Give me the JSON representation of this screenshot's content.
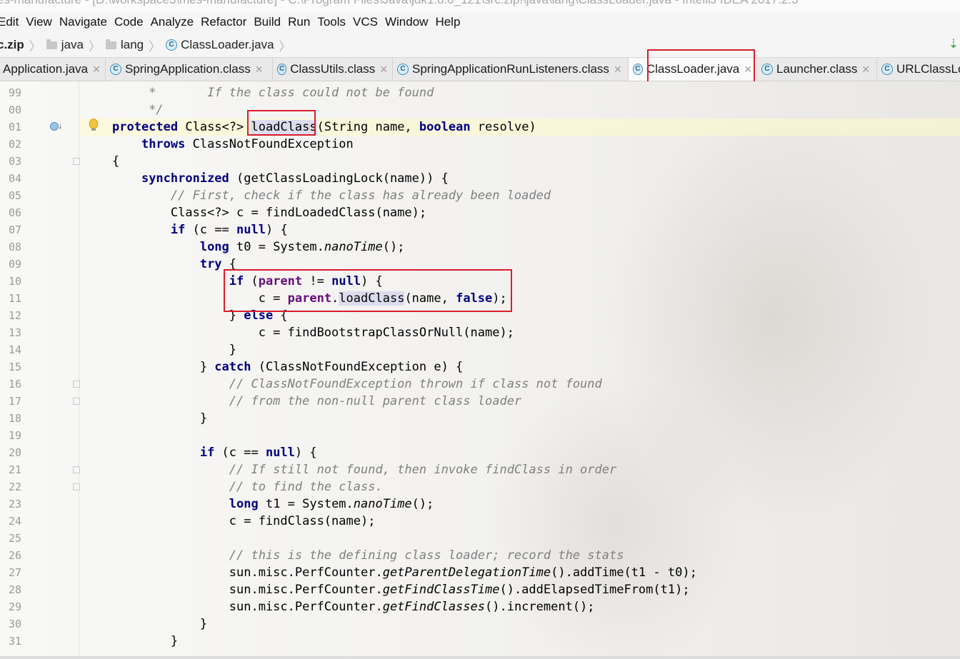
{
  "window": {
    "title": "es-manufacture - [D:\\workspace3\\mes-manufacture] - C:\\Program Files\\Java\\jdk1.8.0_121\\src.zip!\\java\\lang\\ClassLoader.java - IntelliJ IDEA 2017.2.3"
  },
  "menu": {
    "items": [
      "Edit",
      "View",
      "Navigate",
      "Code",
      "Analyze",
      "Refactor",
      "Build",
      "Run",
      "Tools",
      "VCS",
      "Window",
      "Help"
    ]
  },
  "breadcrumb": {
    "items": [
      {
        "label": "c.zip",
        "icon": "archive"
      },
      {
        "label": "java",
        "icon": "folder-icon"
      },
      {
        "label": "lang",
        "icon": "folder-icon"
      },
      {
        "label": "ClassLoader.java",
        "icon": "class-icon"
      }
    ],
    "right_icon": "green-down-arrow-icon"
  },
  "tabs": [
    {
      "label": "Application.java",
      "icon": "none",
      "active": false
    },
    {
      "label": "SpringApplication.class",
      "icon": "class-icon",
      "active": false
    },
    {
      "label": "ClassUtils.class",
      "icon": "class-icon",
      "active": false
    },
    {
      "label": "SpringApplicationRunListeners.class",
      "icon": "class-icon",
      "active": false
    },
    {
      "label": "ClassLoader.java",
      "icon": "class-icon",
      "active": true
    },
    {
      "label": "Launcher.class",
      "icon": "class-icon",
      "active": false
    },
    {
      "label": "URLClassLo",
      "icon": "class-icon",
      "active": false
    }
  ],
  "editor": {
    "line_numbers": [
      "99",
      "00",
      "01",
      "02",
      "03",
      "04",
      "05",
      "06",
      "07",
      "08",
      "09",
      "10",
      "11",
      "12",
      "13",
      "14",
      "15",
      "16",
      "17",
      "18",
      "19",
      "20",
      "21",
      "22",
      "23",
      "24",
      "25",
      "26",
      "27",
      "28",
      "29",
      "30",
      "31"
    ],
    "code": [
      [
        {
          "t": "     *       ",
          "c": "cm"
        },
        {
          "t": "If the class could not be found",
          "c": "cm"
        }
      ],
      [
        {
          "t": "     */",
          "c": "cm"
        }
      ],
      [
        {
          "t": "protected",
          "c": "kw"
        },
        {
          "t": " Class<?> ",
          "c": ""
        },
        {
          "t": "loadClass",
          "c": "hl"
        },
        {
          "t": "(String name, ",
          "c": ""
        },
        {
          "t": "boolean",
          "c": "kw"
        },
        {
          "t": " resolve)",
          "c": ""
        }
      ],
      [
        {
          "t": "    ",
          "c": ""
        },
        {
          "t": "throws",
          "c": "kw"
        },
        {
          "t": " ClassNotFoundException",
          "c": ""
        }
      ],
      [
        {
          "t": "{",
          "c": ""
        }
      ],
      [
        {
          "t": "    ",
          "c": ""
        },
        {
          "t": "synchronized",
          "c": "kw"
        },
        {
          "t": " (getClassLoadingLock(name)) {",
          "c": ""
        }
      ],
      [
        {
          "t": "        ",
          "c": ""
        },
        {
          "t": "// First, check if the class has already been loaded",
          "c": "cm"
        }
      ],
      [
        {
          "t": "        Class<?> c = findLoadedClass(name);",
          "c": ""
        }
      ],
      [
        {
          "t": "        ",
          "c": ""
        },
        {
          "t": "if",
          "c": "kw"
        },
        {
          "t": " (c == ",
          "c": ""
        },
        {
          "t": "null",
          "c": "kw"
        },
        {
          "t": ") {",
          "c": ""
        }
      ],
      [
        {
          "t": "            ",
          "c": ""
        },
        {
          "t": "long",
          "c": "kw"
        },
        {
          "t": " t0 = System.",
          "c": ""
        },
        {
          "t": "nanoTime",
          "c": "it"
        },
        {
          "t": "();",
          "c": ""
        }
      ],
      [
        {
          "t": "            ",
          "c": ""
        },
        {
          "t": "try",
          "c": "kw"
        },
        {
          "t": " {",
          "c": ""
        }
      ],
      [
        {
          "t": "                ",
          "c": ""
        },
        {
          "t": "if",
          "c": "kw"
        },
        {
          "t": " (",
          "c": ""
        },
        {
          "t": "parent",
          "c": "fld"
        },
        {
          "t": " != ",
          "c": ""
        },
        {
          "t": "null",
          "c": "kw"
        },
        {
          "t": ") {",
          "c": ""
        }
      ],
      [
        {
          "t": "                    c = ",
          "c": ""
        },
        {
          "t": "parent",
          "c": "fld"
        },
        {
          "t": ".",
          "c": ""
        },
        {
          "t": "loadClass",
          "c": "hl"
        },
        {
          "t": "(name, ",
          "c": ""
        },
        {
          "t": "false",
          "c": "kw"
        },
        {
          "t": ");",
          "c": ""
        }
      ],
      [
        {
          "t": "                } ",
          "c": ""
        },
        {
          "t": "else",
          "c": "kw"
        },
        {
          "t": " {",
          "c": ""
        }
      ],
      [
        {
          "t": "                    c = findBootstrapClassOrNull(name);",
          "c": ""
        }
      ],
      [
        {
          "t": "                }",
          "c": ""
        }
      ],
      [
        {
          "t": "            } ",
          "c": ""
        },
        {
          "t": "catch",
          "c": "kw"
        },
        {
          "t": " (ClassNotFoundException e) {",
          "c": ""
        }
      ],
      [
        {
          "t": "                ",
          "c": ""
        },
        {
          "t": "// ClassNotFoundException thrown if class not found",
          "c": "cm"
        }
      ],
      [
        {
          "t": "                ",
          "c": ""
        },
        {
          "t": "// from the non-null parent class loader",
          "c": "cm"
        }
      ],
      [
        {
          "t": "            }",
          "c": ""
        }
      ],
      [
        {
          "t": "",
          "c": ""
        }
      ],
      [
        {
          "t": "            ",
          "c": ""
        },
        {
          "t": "if",
          "c": "kw"
        },
        {
          "t": " (c == ",
          "c": ""
        },
        {
          "t": "null",
          "c": "kw"
        },
        {
          "t": ") {",
          "c": ""
        }
      ],
      [
        {
          "t": "                ",
          "c": ""
        },
        {
          "t": "// If still not found, then invoke findClass in order",
          "c": "cm"
        }
      ],
      [
        {
          "t": "                ",
          "c": ""
        },
        {
          "t": "// to find the class.",
          "c": "cm"
        }
      ],
      [
        {
          "t": "                ",
          "c": ""
        },
        {
          "t": "long",
          "c": "kw"
        },
        {
          "t": " t1 = System.",
          "c": ""
        },
        {
          "t": "nanoTime",
          "c": "it"
        },
        {
          "t": "();",
          "c": ""
        }
      ],
      [
        {
          "t": "                c = findClass(name);",
          "c": ""
        }
      ],
      [
        {
          "t": "",
          "c": ""
        }
      ],
      [
        {
          "t": "                ",
          "c": ""
        },
        {
          "t": "// this is the defining class loader; record the stats",
          "c": "cm"
        }
      ],
      [
        {
          "t": "                sun.misc.PerfCounter.",
          "c": ""
        },
        {
          "t": "getParentDelegationTime",
          "c": "it"
        },
        {
          "t": "().addTime(t1 - t0);",
          "c": ""
        }
      ],
      [
        {
          "t": "                sun.misc.PerfCounter.",
          "c": ""
        },
        {
          "t": "getFindClassTime",
          "c": "it"
        },
        {
          "t": "().addElapsedTimeFrom(t1);",
          "c": ""
        }
      ],
      [
        {
          "t": "                sun.misc.PerfCounter.",
          "c": ""
        },
        {
          "t": "getFindClasses",
          "c": "it"
        },
        {
          "t": "().increment();",
          "c": ""
        }
      ],
      [
        {
          "t": "            }",
          "c": ""
        }
      ],
      [
        {
          "t": "        }",
          "c": ""
        }
      ]
    ],
    "gutter_icons": [
      "override-icon",
      "intention-bulb-icon",
      "fold-marker-icon"
    ]
  },
  "colors": {
    "keyword": "#000080",
    "comment": "#808080",
    "field": "#660e7a",
    "annotation_box": "#d81e2a",
    "identifier_highlight": "#dcdcee"
  }
}
